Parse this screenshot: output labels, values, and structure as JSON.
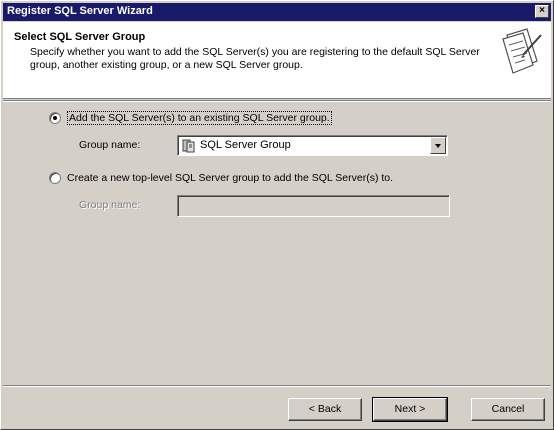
{
  "window": {
    "title": "Register SQL Server Wizard",
    "close_glyph": "×"
  },
  "header": {
    "title": "Select SQL Server Group",
    "description": "Specify whether you want to add the SQL Server(s) you are registering to the default SQL Server group, another existing group, or a new SQL Server group.",
    "icon": "wizard-document-icon"
  },
  "options": {
    "existing_group": {
      "label": "Add the SQL Server(s) to an existing SQL Server group.",
      "checked": true
    },
    "group_name_label": "Group name:",
    "group_name_value": "SQL Server Group",
    "group_icon": "server-group-icon",
    "new_group": {
      "label": "Create a new top-level SQL Server group to add the SQL Server(s) to.",
      "checked": false
    },
    "new_group_name_label": "Group name:",
    "new_group_name_value": ""
  },
  "buttons": {
    "back": "< Back",
    "next": "Next >",
    "cancel": "Cancel"
  }
}
